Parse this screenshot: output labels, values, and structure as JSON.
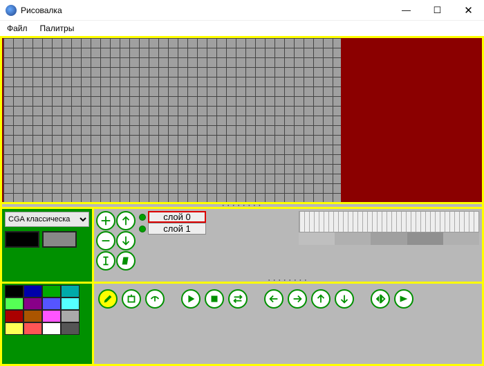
{
  "window": {
    "title": "Рисовалка",
    "minimize": "—",
    "maximize": "☐",
    "close": "✕"
  },
  "menu": {
    "file": "Файл",
    "palettes": "Палитры"
  },
  "palette": {
    "selector_label": "CGA классическа",
    "primary_color": "#000000",
    "secondary_color": "#888888",
    "swatches": [
      "#000000",
      "#0000aa",
      "#00aa00",
      "#00aaaa",
      "#55ff55",
      "#880088",
      "#5555ff",
      "#55ffff",
      "#aa0000",
      "#aa5500",
      "#ff55ff",
      "#aaaaaa",
      "#ffff55",
      "#ff5555",
      "#ffffff",
      "#555555"
    ]
  },
  "layers": {
    "items": [
      {
        "name": "слой 0",
        "active": true
      },
      {
        "name": "слой 1",
        "active": false
      }
    ]
  },
  "frame_shades": [
    "#bfbfbf",
    "#b0b0b0",
    "#a0a0a0",
    "#909090",
    "#b0b0b0"
  ],
  "icons": {
    "plus": "✚",
    "minus": "━",
    "arrow_up": "↑",
    "arrow_down": "↓"
  }
}
